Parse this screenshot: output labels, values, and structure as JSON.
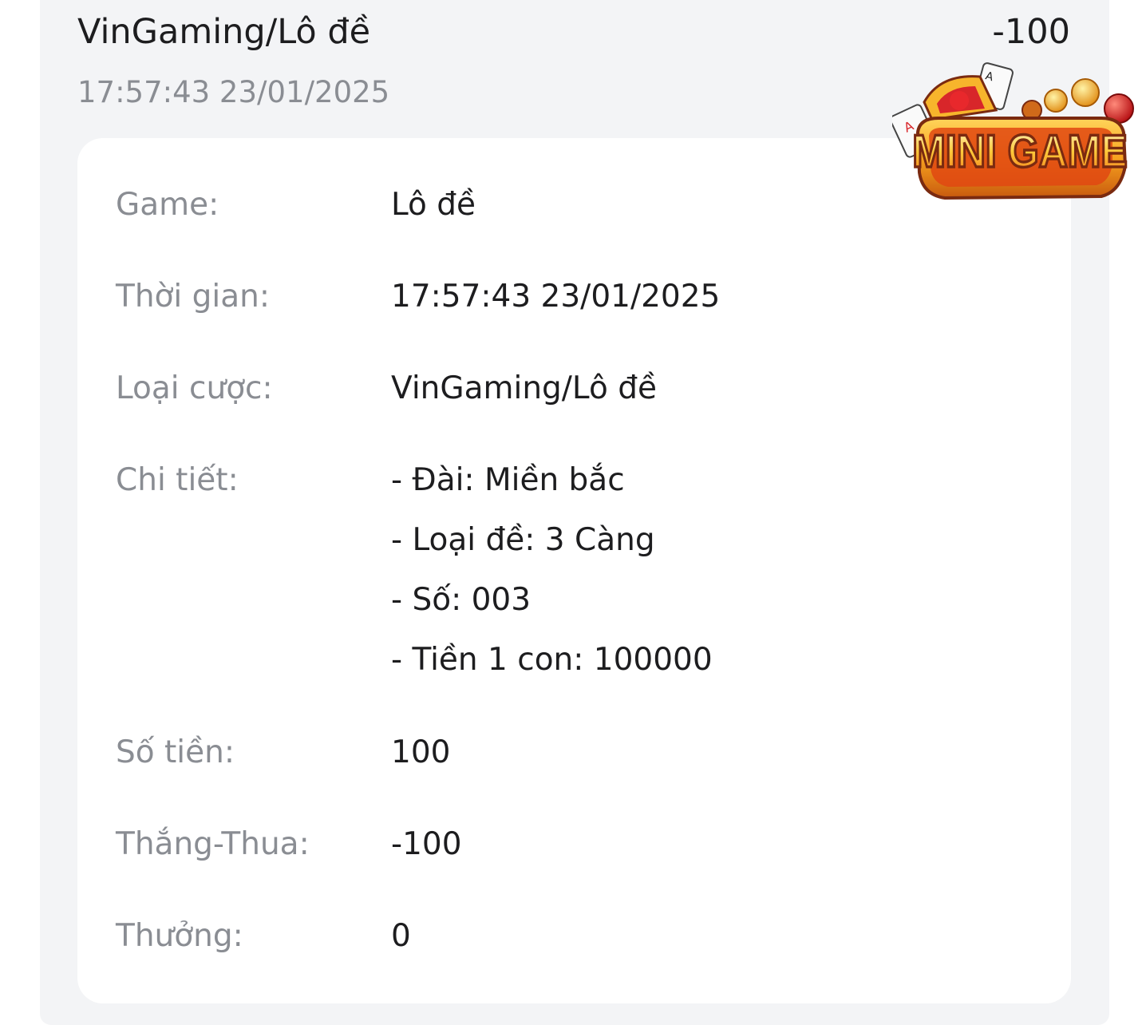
{
  "header": {
    "title": "VinGaming/Lô đề",
    "amount": "-100",
    "time": "17:57:43 23/01/2025"
  },
  "details": {
    "game_label": "Game:",
    "game_value": "Lô đề",
    "time_label": "Thời gian:",
    "time_value": "17:57:43 23/01/2025",
    "bet_type_label": "Loại cược:",
    "bet_type_value": "VinGaming/Lô đề",
    "detail_label": "Chi tiết:",
    "detail_lines": [
      "- Đài: Miền bắc",
      "- Loại đề: 3 Càng",
      "- Số: 003",
      "- Tiền 1 con: 100000"
    ],
    "amount_label": "Số tiền:",
    "amount_value": "100",
    "winloss_label": "Thắng-Thua:",
    "winloss_value": "-100",
    "bonus_label": "Thưởng:",
    "bonus_value": "0"
  },
  "logo": {
    "text": "MINI GAME",
    "icon": "mini-game-logo-icon",
    "colors": {
      "gold": "#f7b52c",
      "orange": "#f07a1a",
      "red": "#d8262a",
      "dark": "#7a2a10"
    }
  },
  "colors": {
    "outer_bg": "#f3f4f6",
    "card_bg": "#ffffff",
    "label": "#8a8d93",
    "value": "#1d1d1f"
  }
}
